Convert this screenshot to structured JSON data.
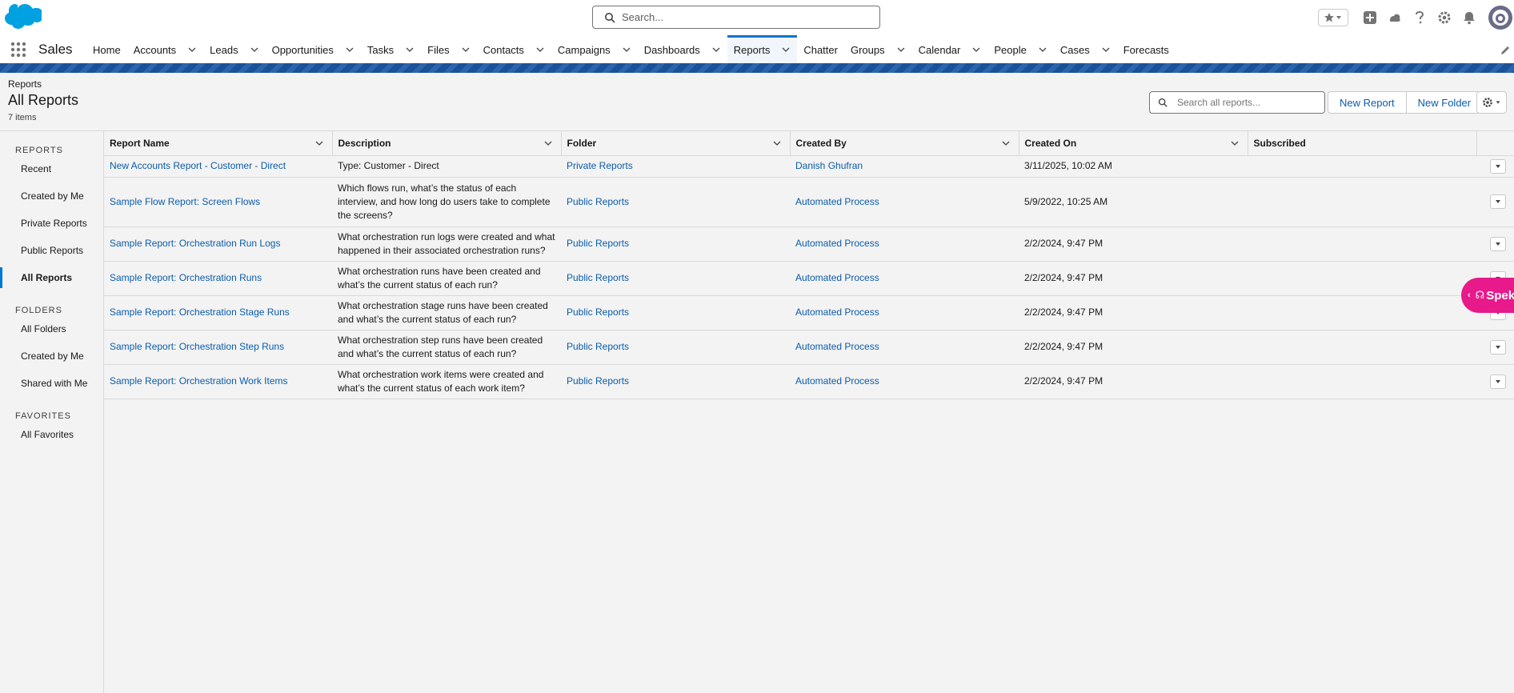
{
  "header": {
    "search_placeholder": "Search..."
  },
  "nav": {
    "app_name": "Sales",
    "items": [
      {
        "label": "Home",
        "chevron": false
      },
      {
        "label": "Accounts",
        "chevron": true
      },
      {
        "label": "Leads",
        "chevron": true
      },
      {
        "label": "Opportunities",
        "chevron": true
      },
      {
        "label": "Tasks",
        "chevron": true
      },
      {
        "label": "Files",
        "chevron": true
      },
      {
        "label": "Contacts",
        "chevron": true
      },
      {
        "label": "Campaigns",
        "chevron": true
      },
      {
        "label": "Dashboards",
        "chevron": true
      },
      {
        "label": "Reports",
        "chevron": true,
        "active": true
      },
      {
        "label": "Chatter",
        "chevron": false
      },
      {
        "label": "Groups",
        "chevron": true
      },
      {
        "label": "Calendar",
        "chevron": true
      },
      {
        "label": "People",
        "chevron": true
      },
      {
        "label": "Cases",
        "chevron": true
      },
      {
        "label": "Forecasts",
        "chevron": false
      }
    ]
  },
  "page": {
    "breadcrumb": "Reports",
    "title": "All Reports",
    "count": "7 items",
    "search_placeholder": "Search all reports...",
    "new_report_label": "New Report",
    "new_folder_label": "New Folder"
  },
  "sidebar": {
    "reports_header": "REPORTS",
    "report_items": [
      "Recent",
      "Created by Me",
      "Private Reports",
      "Public Reports",
      "All Reports"
    ],
    "folders_header": "FOLDERS",
    "folder_items": [
      "All Folders",
      "Created by Me",
      "Shared with Me"
    ],
    "favorites_header": "FAVORITES",
    "favorite_items": [
      "All Favorites"
    ]
  },
  "table": {
    "columns": [
      "Report Name",
      "Description",
      "Folder",
      "Created By",
      "Created On",
      "Subscribed"
    ],
    "rows": [
      {
        "name": "New Accounts Report - Customer - Direct",
        "description": "Type: Customer - Direct",
        "folder": "Private Reports",
        "created_by": "Danish Ghufran",
        "created_on": "3/11/2025, 10:02 AM"
      },
      {
        "name": "Sample Flow Report: Screen Flows",
        "description": "Which flows run, what’s the status of each interview, and how long do users take to complete the screens?",
        "folder": "Public Reports",
        "created_by": "Automated Process",
        "created_on": "5/9/2022, 10:25 AM"
      },
      {
        "name": "Sample Report: Orchestration Run Logs",
        "description": "What orchestration run logs were created and what happened in their associated orchestration runs?",
        "folder": "Public Reports",
        "created_by": "Automated Process",
        "created_on": "2/2/2024, 9:47 PM"
      },
      {
        "name": "Sample Report: Orchestration Runs",
        "description": "What orchestration runs have been created and what’s the current status of each run?",
        "folder": "Public Reports",
        "created_by": "Automated Process",
        "created_on": "2/2/2024, 9:47 PM"
      },
      {
        "name": "Sample Report: Orchestration Stage Runs",
        "description": "What orchestration stage runs have been created and what’s the current status of each run?",
        "folder": "Public Reports",
        "created_by": "Automated Process",
        "created_on": "2/2/2024, 9:47 PM"
      },
      {
        "name": "Sample Report: Orchestration Step Runs",
        "description": "What orchestration step runs have been created and what’s the current status of each run?",
        "folder": "Public Reports",
        "created_by": "Automated Process",
        "created_on": "2/2/2024, 9:47 PM"
      },
      {
        "name": "Sample Report: Orchestration Work Items",
        "description": "What orchestration work items were created and what’s the current status of each work item?",
        "folder": "Public Reports",
        "created_by": "Automated Process",
        "created_on": "2/2/2024, 9:47 PM"
      }
    ]
  },
  "widget": {
    "label": "Spek"
  },
  "colors": {
    "brand_blue": "#0176d3",
    "link_blue": "#0b5cab",
    "widget_pink": "#e8198b"
  }
}
